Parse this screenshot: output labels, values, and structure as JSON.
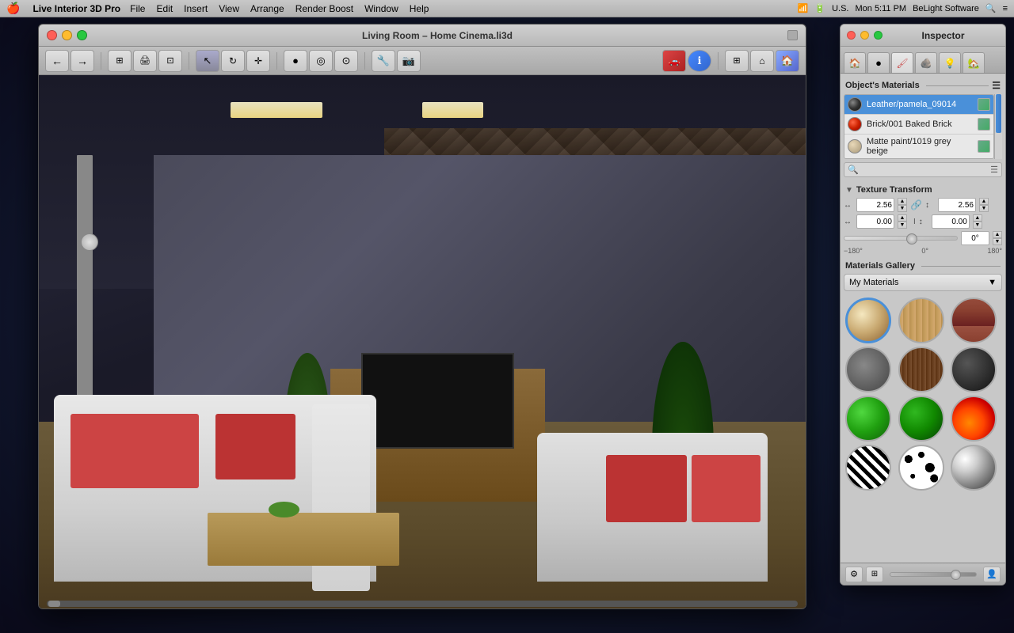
{
  "menubar": {
    "apple": "🍎",
    "app_name": "Live Interior 3D Pro",
    "menus": [
      "File",
      "Edit",
      "Insert",
      "View",
      "Arrange",
      "Render Boost",
      "Window",
      "Help"
    ],
    "right": {
      "icons": "🔍 icons...",
      "locale": "U.S.",
      "time": "Mon 5:11 PM",
      "company": "BeLight Software",
      "search_icon": "🔍",
      "menu_icon": "≡"
    }
  },
  "window": {
    "title": "Living Room – Home Cinema.li3d",
    "traffic_lights": {
      "red": "close",
      "yellow": "minimize",
      "green": "zoom"
    }
  },
  "inspector": {
    "title": "Inspector",
    "tabs": [
      "house-icon",
      "sphere-icon",
      "brush-icon",
      "material-icon",
      "light-icon",
      "room-icon"
    ],
    "objects_materials_label": "Object's Materials",
    "materials": [
      {
        "name": "Leather/pamela_09014",
        "swatch_type": "swatch-dark"
      },
      {
        "name": "Brick/001 Baked Brick",
        "swatch_type": "swatch-red"
      },
      {
        "name": "Matte paint/1019 grey beige",
        "swatch_type": "swatch-beige"
      }
    ],
    "texture_transform": {
      "label": "Texture Transform",
      "scale_x_label": "↔",
      "scale_x_value": "2.56",
      "scale_y_label": "↕",
      "scale_y_value": "2.56",
      "offset_x_label": "↔",
      "offset_x_value": "0.00",
      "offset_y_label": "↕",
      "offset_y_value": "0.00",
      "rotation_label": "0°",
      "rotation_min": "−180°",
      "rotation_mid": "0°",
      "rotation_max": "180°"
    },
    "gallery": {
      "label": "Materials Gallery",
      "dropdown_value": "My Materials",
      "materials": [
        {
          "type": "mat-cream",
          "name": "cream-material"
        },
        {
          "type": "mat-wood-light",
          "name": "light-wood-material"
        },
        {
          "type": "mat-brick",
          "name": "brick-material"
        },
        {
          "type": "mat-stone",
          "name": "stone-material"
        },
        {
          "type": "mat-wood-dark",
          "name": "dark-wood-material"
        },
        {
          "type": "mat-dark",
          "name": "dark-material"
        },
        {
          "type": "mat-green-bright",
          "name": "bright-green-material"
        },
        {
          "type": "mat-green-dark",
          "name": "dark-green-material"
        },
        {
          "type": "mat-fire",
          "name": "fire-material"
        },
        {
          "type": "mat-zebra",
          "name": "zebra-material"
        },
        {
          "type": "mat-dalmatian",
          "name": "dalmatian-material"
        },
        {
          "type": "mat-chrome",
          "name": "chrome-material"
        }
      ]
    }
  },
  "toolbar": {
    "buttons": [
      "←",
      "→",
      "⊞",
      "🖨",
      "⊡",
      "↖",
      "◎",
      "⊙",
      "⊘",
      "🔧",
      "📷",
      "🎥",
      "ℹ",
      "⊡",
      "⌂",
      "🏠"
    ]
  }
}
